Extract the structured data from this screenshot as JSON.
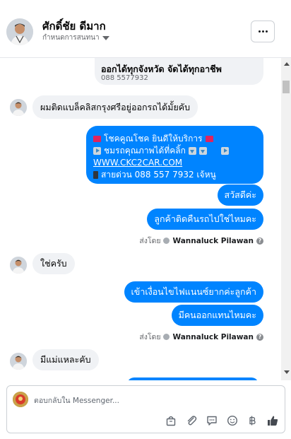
{
  "header": {
    "name": "ศักดิ์ชัย ดีมาก",
    "subtitle": "กำหนดการสนทนา",
    "more_label": "More options"
  },
  "thread": {
    "card": {
      "title": "ออกได้ทุกจังหวัด จัดได้ทุกอาชีพ",
      "phone": "088 5577932"
    },
    "messages": [
      {
        "from": "customer",
        "text": "ผมติดแบล็คลิสกรุงศรีอยู่ออกรถได้มั้ยคับ"
      },
      {
        "from": "page",
        "lines": [
          "โชคคูณโชค ยินดีให้บริการ",
          "ชมรถคุณภาพได้ที่คลิ้ก",
          "WWW.CKC2CAR.COM",
          "สายด่วน 088 557 7932 เจ้หนู"
        ]
      },
      {
        "from": "page",
        "text": "สวัสดีค่ะ"
      },
      {
        "from": "page",
        "text": "ลูกค้าติดคืนรถไปใช่ไหมคะ"
      },
      {
        "from": "customer",
        "text": "ใช่ครับ"
      },
      {
        "from": "page",
        "text": "เข้าเงื่อนไขไฟแนนซ์ยากค่ะลูกค้า"
      },
      {
        "from": "page",
        "text": "มีคนออกแทนไหมคะ"
      },
      {
        "from": "customer",
        "text": "มีแม่แหละคับ"
      }
    ],
    "sent_by_label": "ส่งโดย",
    "sent_by_name": "Wannaluck Pilawan",
    "help_glyph": "?"
  },
  "composer": {
    "placeholder": "ตอบกลับใน Messenger...",
    "tools": [
      "bag-icon",
      "attachment-icon",
      "saved-reply-icon",
      "emoji-icon",
      "baht-icon",
      "like-icon"
    ]
  },
  "colors": {
    "outgoing_bubble": "#0084ff",
    "incoming_bubble": "#f0f2f5",
    "muted_text": "#65676b"
  }
}
